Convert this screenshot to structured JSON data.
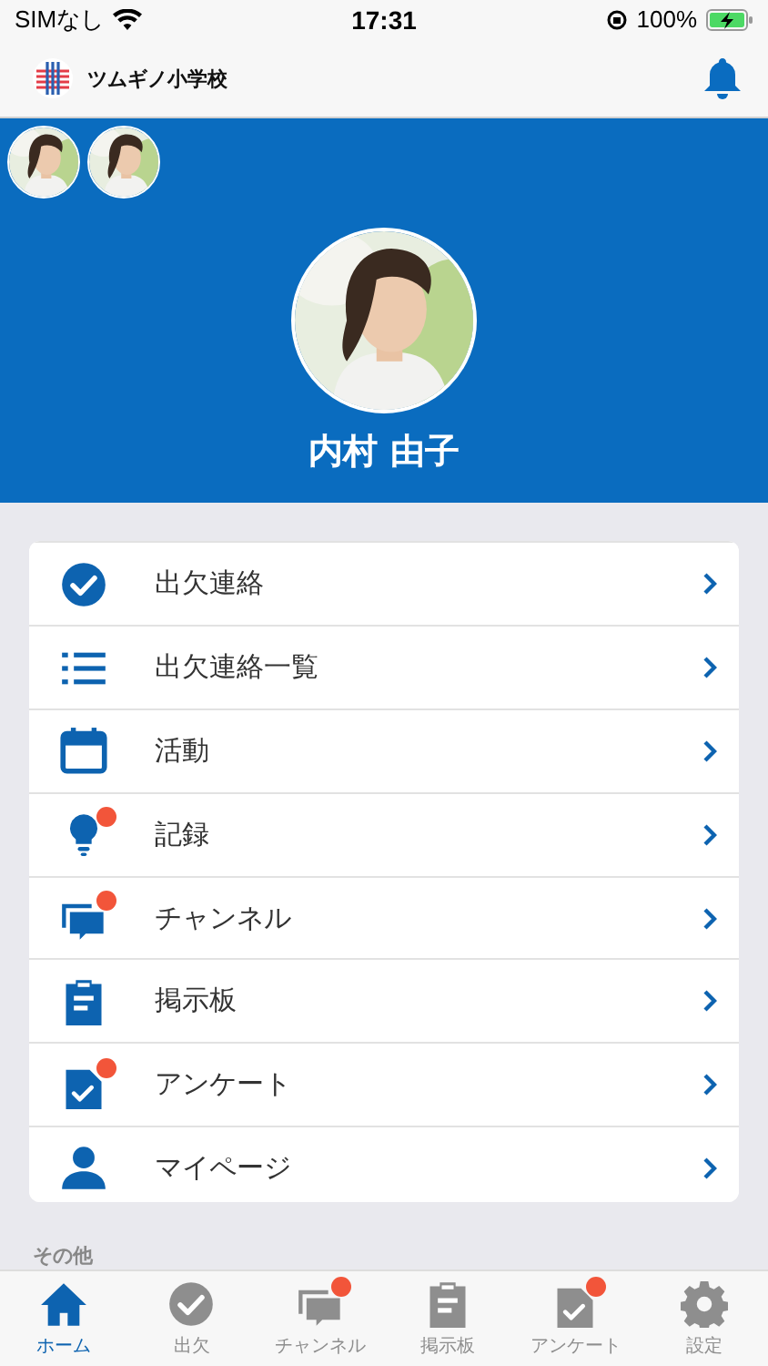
{
  "status_bar": {
    "carrier": "SIMなし",
    "time": "17:31",
    "battery": "100%"
  },
  "header": {
    "school_name": "ツムギノ小学校"
  },
  "profile": {
    "name": "内村 由子"
  },
  "menu": [
    {
      "kind": "check",
      "label": "出欠連絡",
      "badge": false
    },
    {
      "kind": "list",
      "label": "出欠連絡一覧",
      "badge": false
    },
    {
      "kind": "calendar",
      "label": "活動",
      "badge": false
    },
    {
      "kind": "bulb",
      "label": "記録",
      "badge": true
    },
    {
      "kind": "chat",
      "label": "チャンネル",
      "badge": true
    },
    {
      "kind": "clipboard",
      "label": "掲示板",
      "badge": false
    },
    {
      "kind": "survey",
      "label": "アンケート",
      "badge": true
    },
    {
      "kind": "person",
      "label": "マイページ",
      "badge": false
    }
  ],
  "section_label": "その他",
  "tabs": [
    {
      "kind": "home",
      "label": "ホーム",
      "selected": true,
      "badge": false
    },
    {
      "kind": "check",
      "label": "出欠",
      "selected": false,
      "badge": false
    },
    {
      "kind": "chat",
      "label": "チャンネル",
      "selected": false,
      "badge": true
    },
    {
      "kind": "clipboard",
      "label": "掲示板",
      "selected": false,
      "badge": false
    },
    {
      "kind": "survey",
      "label": "アンケート",
      "selected": false,
      "badge": true
    },
    {
      "kind": "gear",
      "label": "設定",
      "selected": false,
      "badge": false
    }
  ]
}
